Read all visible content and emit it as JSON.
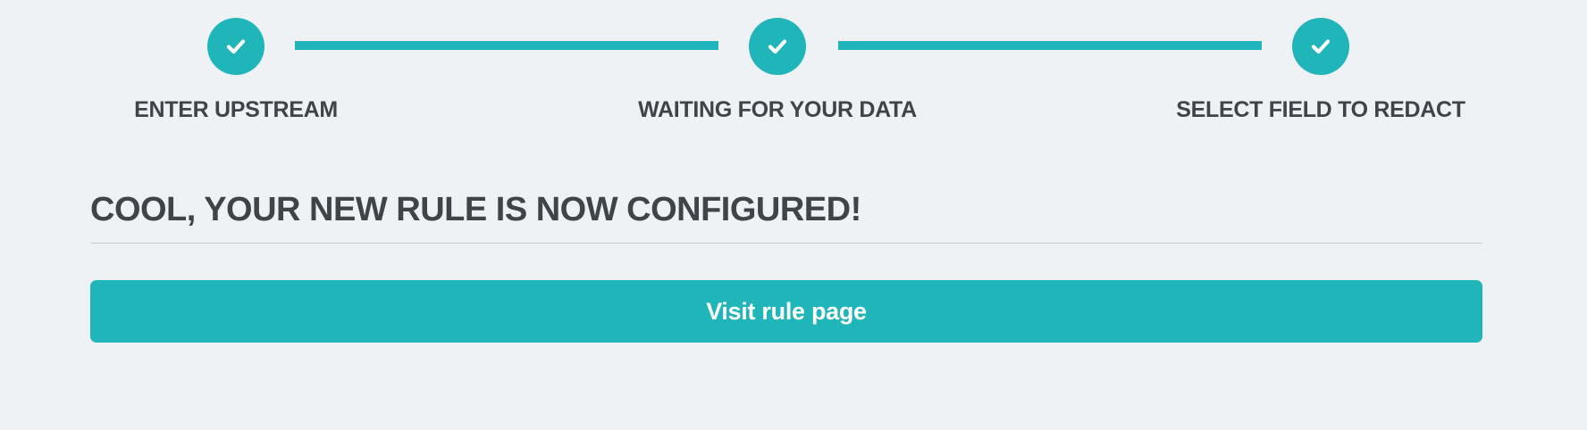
{
  "colors": {
    "accent": "#20b5b9",
    "background": "#eff2f5",
    "text": "#3f4449",
    "divider": "#c8cdd2"
  },
  "stepper": {
    "steps": [
      {
        "label": "ENTER UPSTREAM",
        "status": "completed",
        "icon": "check-icon"
      },
      {
        "label": "WAITING FOR YOUR DATA",
        "status": "completed",
        "icon": "check-icon"
      },
      {
        "label": "SELECT FIELD TO REDACT",
        "status": "completed",
        "icon": "check-icon"
      }
    ]
  },
  "main": {
    "title": "COOL, YOUR NEW RULE IS NOW CONFIGURED!",
    "button_label": "Visit rule page"
  }
}
